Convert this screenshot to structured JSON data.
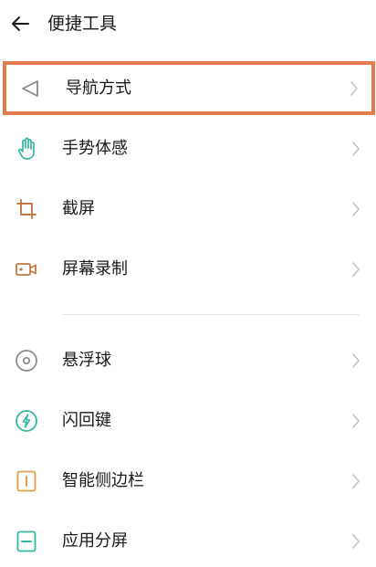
{
  "header": {
    "back_icon": "back-arrow-icon",
    "title": "便捷工具"
  },
  "section_one": [
    {
      "label": "导航方式",
      "icon": "navigation-triangle-icon",
      "icon_color": "#8a8a8a",
      "highlighted": true
    },
    {
      "label": "手势体感",
      "icon": "hand-gesture-icon",
      "icon_color": "#35b6a0",
      "highlighted": false
    },
    {
      "label": "截屏",
      "icon": "crop-icon",
      "icon_color": "#c47a46",
      "highlighted": false
    },
    {
      "label": "屏幕录制",
      "icon": "video-record-icon",
      "icon_color": "#c47a46",
      "highlighted": false
    }
  ],
  "section_two": [
    {
      "label": "悬浮球",
      "icon": "floating-ball-icon",
      "icon_color": "#8a8a8a"
    },
    {
      "label": "闪回键",
      "icon": "flash-key-icon",
      "icon_color": "#35b6a0"
    },
    {
      "label": "智能侧边栏",
      "icon": "sidebar-icon",
      "icon_color": "#d9a24a"
    },
    {
      "label": "应用分屏",
      "icon": "split-screen-icon",
      "icon_color": "#35b6a0"
    }
  ],
  "colors": {
    "highlight_border": "#e07c4e",
    "chevron": "#c4c4c4",
    "divider": "#e6e6e6"
  }
}
